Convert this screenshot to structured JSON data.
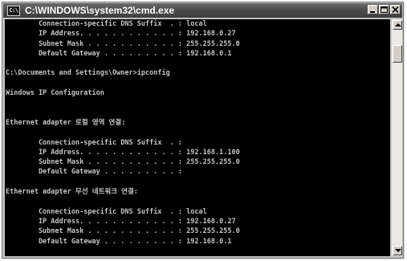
{
  "window": {
    "icon_label": "C:\\",
    "title": "C:\\WINDOWS\\system32\\cmd.exe",
    "buttons": [
      "minimize",
      "maximize",
      "close"
    ]
  },
  "console": {
    "lines": [
      "        Connection-specific DNS Suffix  . : local",
      "        IP Address. . . . . . . . . . . . : 192.168.0.27",
      "        Subnet Mask . . . . . . . . . . . : 255.255.255.0",
      "        Default Gateway . . . . . . . . . : 192.168.0.1",
      "",
      "C:\\Documents and Settings\\Owner>ipconfig",
      "",
      "Windows IP Configuration",
      "",
      "",
      "Ethernet adapter 로컬 영역 연결:",
      "",
      "        Connection-specific DNS Suffix  . :",
      "        IP Address. . . . . . . . . . . . : 192.168.1.100",
      "        Subnet Mask . . . . . . . . . . . : 255.255.255.0",
      "        Default Gateway . . . . . . . . . :",
      "",
      "Ethernet adapter 무선 네트워크 연결:",
      "",
      "        Connection-specific DNS Suffix  . : local",
      "        IP Address. . . . . . . . . . . . : 192.168.0.27",
      "        Subnet Mask . . . . . . . . . . . : 255.255.255.0",
      "        Default Gateway . . . . . . . . . : 192.168.0.1",
      "",
      "C:\\Documents and Settings\\Owner>"
    ]
  }
}
